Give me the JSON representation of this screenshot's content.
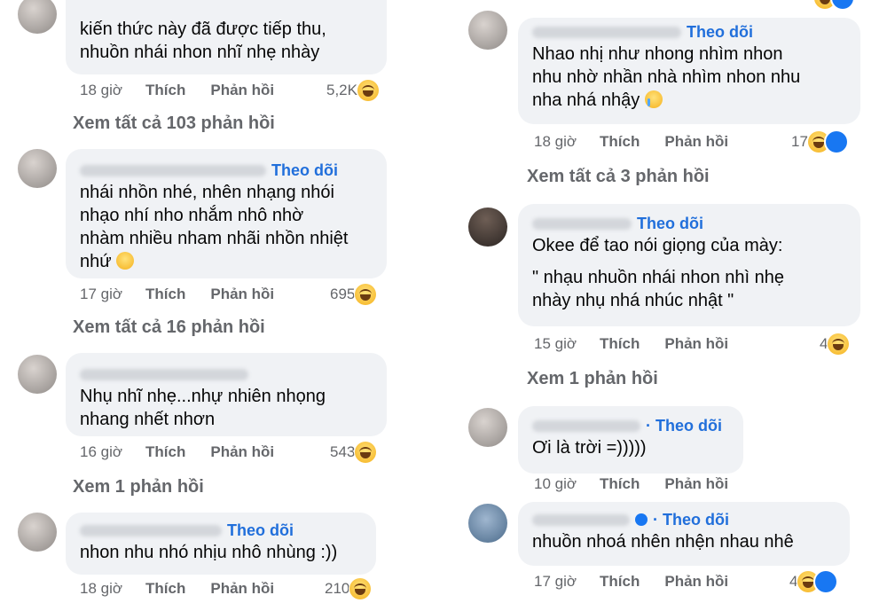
{
  "left": {
    "c1": {
      "text": "kiến thức này đã được tiếp thu,\nnhuồn nhái nhon nhĩ nhẹ nhày",
      "time": "18 giờ",
      "like": "Thích",
      "reply": "Phản hồi",
      "count": "5,2K"
    },
    "v1": "Xem tất cả 103 phản hồi",
    "c2": {
      "follow": "Theo dõi",
      "text": "nhái nhồn nhé, nhên nhạng nhói\nnhạo nhí nho nhắm nhô nhờ\nnhàm nhiều nham nhãi nhồn nhiệt\nnhứ",
      "time": "17 giờ",
      "like": "Thích",
      "reply": "Phản hồi",
      "count": "695"
    },
    "v2": "Xem tất cả 16 phản hồi",
    "c3": {
      "text": "Nhụ nhĩ nhẹ...nhự nhiên nhọng\nnhang nhết nhơn",
      "time": "16 giờ",
      "like": "Thích",
      "reply": "Phản hồi",
      "count": "543"
    },
    "v3": "Xem 1 phản hồi",
    "c4": {
      "follow": "Theo dõi",
      "text": "nhon nhu nhó nhịu nhô nhùng :))",
      "time": "18 giờ",
      "like": "Thích",
      "reply": "Phản hồi",
      "count": "210"
    }
  },
  "right": {
    "c1": {
      "follow": "Theo dõi",
      "text": "Nhao nhị như nhong nhìm nhon\nnhu nhờ nhần nhà nhìm nhon nhu\nnha nhá nhậy",
      "time": "18 giờ",
      "like": "Thích",
      "reply": "Phản hồi",
      "count": "17"
    },
    "v1": "Xem tất cả 3 phản hồi",
    "c2": {
      "follow": "Theo dõi",
      "text": "Okee để tao nói giọng của mày:",
      "quote": "\" nhạu nhuồn nhái nhon nhì nhẹ\nnhày nhụ nhá nhúc nhật \"",
      "time": "15 giờ",
      "like": "Thích",
      "reply": "Phản hồi",
      "count": "4"
    },
    "v2": "Xem 1 phản hồi",
    "c3": {
      "follow": "· Theo dõi",
      "text": "Ơi là trời =)))))",
      "time": "10 giờ",
      "like": "Thích",
      "reply": "Phản hồi"
    },
    "c4": {
      "follow": "· Theo dõi",
      "text": "nhuồn nhoá nhên nhện nhau nhê",
      "time": "17 giờ",
      "like": "Thích",
      "reply": "Phản hồi",
      "count": "4"
    }
  },
  "icons": {
    "reaction": "haha-emoji-icon",
    "like": "like-thumb-icon",
    "smile": "smile-emoji-icon",
    "cry": "crying-emoji-icon",
    "verified": "verified-badge-icon"
  },
  "colors": {
    "follow": "#216fdb",
    "bubble": "#f0f2f5",
    "meta": "#65676b"
  }
}
